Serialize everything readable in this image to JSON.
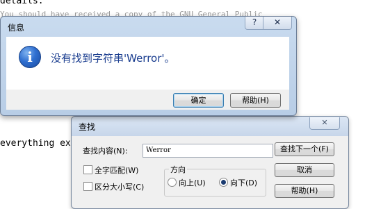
{
  "background": {
    "lines": [
      "details.",
      "You should have received a copy of the GNU General Public",
      "everything exc"
    ]
  },
  "info_dialog": {
    "title": "信息",
    "help_glyph": "?",
    "close_glyph": "✕",
    "icon_glyph": "i",
    "message": "没有找到字符串'Werror'。",
    "ok_label": "确定",
    "help_label": "帮助(H)"
  },
  "find_dialog": {
    "title": "查找",
    "close_glyph": "✕",
    "find_label": "查找内容(N):",
    "find_value": "Werror",
    "find_next_label": "查找下一个(F)",
    "cancel_label": "取消",
    "help_label": "帮助(H)",
    "whole_word_label": "全字匹配(W)",
    "match_case_label": "区分大小写(C)",
    "direction_label": "方向",
    "up_label": "向上(U)",
    "down_label": "向下(D)",
    "direction_selected": "down"
  }
}
